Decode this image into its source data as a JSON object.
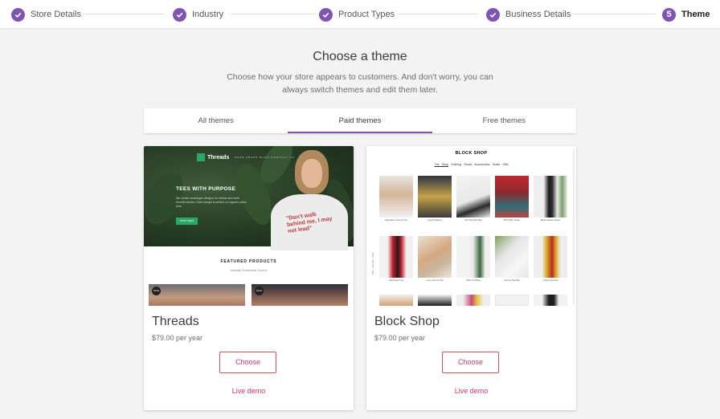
{
  "stepper": {
    "steps": [
      {
        "label": "Store Details",
        "state": "done"
      },
      {
        "label": "Industry",
        "state": "done"
      },
      {
        "label": "Product Types",
        "state": "done"
      },
      {
        "label": "Business Details",
        "state": "done"
      },
      {
        "label": "Theme",
        "state": "current",
        "number": "5"
      }
    ]
  },
  "header": {
    "title": "Choose a theme",
    "subtitle": "Choose how your store appears to customers. And don't worry, you can always switch themes and edit them later."
  },
  "tabs": [
    {
      "label": "All themes",
      "active": false
    },
    {
      "label": "Paid themes",
      "active": true
    },
    {
      "label": "Free themes",
      "active": false
    }
  ],
  "themes": [
    {
      "name": "Threads",
      "price": "$79.00 per year",
      "choose_label": "Choose",
      "demo_label": "Live demo",
      "preview": {
        "logo": "Threads",
        "nav": "SHOP ABOUT BLOG CONTACT US",
        "headline": "TEES WITH PURPOSE",
        "body": "We create meaningful designs for ethical and earth friendly fashion. Each design is printed on organic cotton tees.",
        "button": "SHOP TEES",
        "shirt_text": "\"Don't walk behind me, I may not lead\"",
        "featured_title": "FEATURED PRODUCTS",
        "featured_sub": "Naturally Sustainable Fashion",
        "sale_badge": "SALE"
      }
    },
    {
      "name": "Block Shop",
      "price": "$79.00 per year",
      "choose_label": "Choose",
      "demo_label": "Live demo",
      "preview": {
        "store_title": "BLOCK SHOP",
        "nav_items": [
          "The Shop",
          "Clothing",
          "Shoes",
          "Accessories",
          "Outlet",
          "Gifts"
        ],
        "sidebar_text": "Men · Women · Kids",
        "product_captions": [
          "Sleeveless Summer Top",
          "Graphic Beanie",
          "Mini Shoulder Bag",
          "Red Puffer Jacket",
          "Black Leather Jacket",
          "Red Wrap Coat",
          "Linen Summer Set",
          "Plant Pot White",
          "Canvas Tote Bag",
          "Yellow Jumpsuit"
        ]
      }
    }
  ],
  "colors": {
    "accent": "#7f54b3",
    "link": "#c9356e",
    "threads_green": "#2aa86a"
  }
}
